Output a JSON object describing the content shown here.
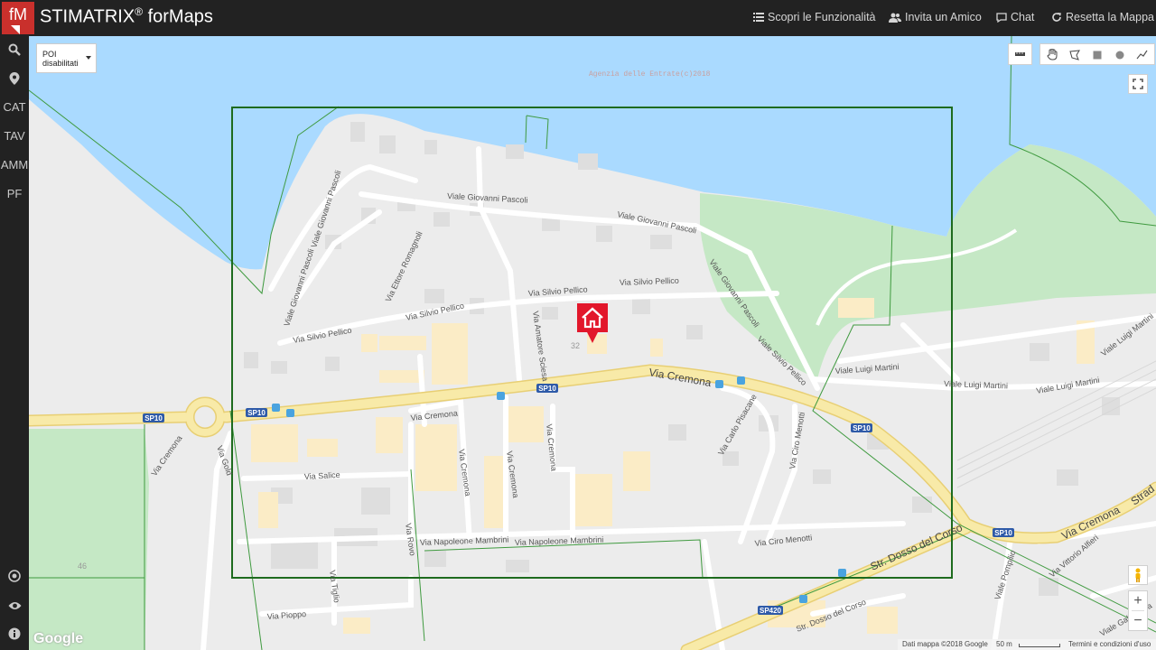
{
  "app": {
    "title": "STIMATRIX",
    "title_suffix": " forMaps",
    "logo_text": "fM",
    "reg_mark": "®"
  },
  "header": {
    "nav": [
      {
        "icon": "list-icon",
        "label": "Scopri le Funzionalità"
      },
      {
        "icon": "users-icon",
        "label": "Invita un Amico"
      },
      {
        "icon": "chat-icon",
        "label": "Chat"
      },
      {
        "icon": "refresh-icon",
        "label": "Resetta la Mappa"
      }
    ]
  },
  "sidebar": {
    "top": [
      {
        "type": "icon",
        "name": "search-icon"
      },
      {
        "type": "icon",
        "name": "map-marker-icon"
      },
      {
        "type": "text",
        "label": "CAT"
      },
      {
        "type": "text",
        "label": "TAV"
      },
      {
        "type": "text",
        "label": "AMM"
      },
      {
        "type": "text",
        "label": "PF"
      }
    ],
    "bottom": [
      {
        "type": "icon",
        "name": "target-icon"
      },
      {
        "type": "icon",
        "name": "eye-icon"
      },
      {
        "type": "icon",
        "name": "info-icon"
      }
    ]
  },
  "map": {
    "poi_select": {
      "label_line1": "POI",
      "label_line2": "disabilitati"
    },
    "watermark": "Agenzia delle Entrate(c)2018",
    "streets": {
      "pascoli_1": "Viale Giovanni Pascoli",
      "pascoli_2": "Viale Giovanni Pascoli",
      "pascoli_3": "Viale Giovanni Pascoli",
      "pascoli_4": "Viale Giovanni Pascoli",
      "pascoli_5": "Viale Giovanni Pascoli",
      "romagnoli": "Via Ettore Romagnoli",
      "pellico_1": "Via Silvio Pellico",
      "pellico_2": "Via Silvio Pellico",
      "pellico_3": "Via Silvio Pellico",
      "pellico_4": "Via Silvio Pellico",
      "pellico_5": "Viale Silvio Pellico",
      "sciesa": "Via Amatore Sciesa",
      "cremona_main": "Via Cremona",
      "cremona_2": "Via Cremona",
      "cremona_3": "Via Cremona",
      "cremona_4": "Via Cremona",
      "cremona_5": "Via Cremona",
      "cremona_6": "Via Cremona",
      "cremona_east": "Via Cremona",
      "salice": "Via Salice",
      "rovo": "Via Rovo",
      "tiglio": "Via Tiglio",
      "pioppo": "Via Pioppo",
      "mambrini_1": "Via Napoleone Mambrini",
      "mambrini_2": "Via Napoleone Mambrini",
      "pisacane": "Via Carlo Pisacane",
      "menotti_1": "Via Ciro Menotti",
      "menotti_2": "Via Ciro Menotti",
      "martini_1": "Viale Luigi Martini",
      "martini_2": "Viale Luigi Martini",
      "martini_3": "Viale Luigi Martini",
      "martini_4": "Viale Luigi Martini",
      "dosso_1": "Str. Dosso del Corso",
      "dosso_2": "Str. Dosso del Corso",
      "pompilio": "Viale Pompilio",
      "alfieri": "Via Vittorio Alfieri",
      "galileo": "Viale Galileo Ga",
      "strad": "Strad",
      "gold": "Via Gold"
    },
    "shields": [
      "SP10",
      "SP10",
      "SP10",
      "SP10",
      "SP10",
      "SP420"
    ],
    "house_number": "32",
    "parcel_number": "46",
    "attribution": {
      "google": "Google",
      "data": "Dati mappa ©2018 Google",
      "scale": "50 m",
      "terms": "Termini e condizioni d'uso"
    },
    "zoom": {
      "in": "+",
      "out": "−"
    },
    "colors": {
      "water": "#aadaff",
      "park": "#c5e8c5",
      "road_major": "#f5e8a3",
      "bbox": "#1e6b1e",
      "marker": "#e2172b"
    }
  }
}
